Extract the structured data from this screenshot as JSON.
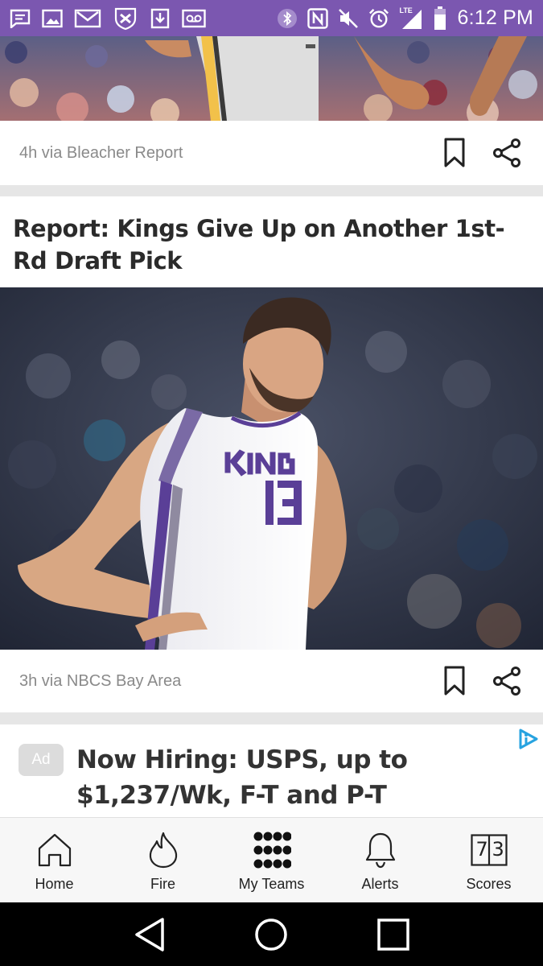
{
  "status_bar": {
    "time": "6:12 PM",
    "network": "LTE",
    "colors": {
      "background": "#7b57b0"
    },
    "icons_left": [
      "message-icon",
      "image-icon",
      "gmail-icon",
      "team-logo-icon",
      "download-icon",
      "voicemail-icon"
    ],
    "icons_right": [
      "bluetooth-icon",
      "nfc-icon",
      "mute-icon",
      "alarm-icon",
      "signal-icon",
      "battery-icon"
    ]
  },
  "feed": {
    "cards": [
      {
        "meta": "4h via Bleacher Report"
      },
      {
        "headline": "Report: Kings Give Up on Another 1st-Rd Draft Pick",
        "meta": "3h via NBCS Bay Area"
      }
    ],
    "ad": {
      "badge": "Ad",
      "title": "Now Hiring: USPS, up to $1,237/Wk, F-T and P-T"
    }
  },
  "bottom_nav": {
    "items": [
      {
        "label": "Home",
        "icon": "home-icon"
      },
      {
        "label": "Fire",
        "icon": "fire-icon"
      },
      {
        "label": "My Teams",
        "icon": "grid-dots-icon"
      },
      {
        "label": "Alerts",
        "icon": "bell-icon"
      },
      {
        "label": "Scores",
        "icon": "scores-icon",
        "icon_text": [
          "7",
          "3"
        ]
      }
    ]
  },
  "system_nav": [
    "back-icon",
    "home-circle-icon",
    "recents-icon"
  ]
}
